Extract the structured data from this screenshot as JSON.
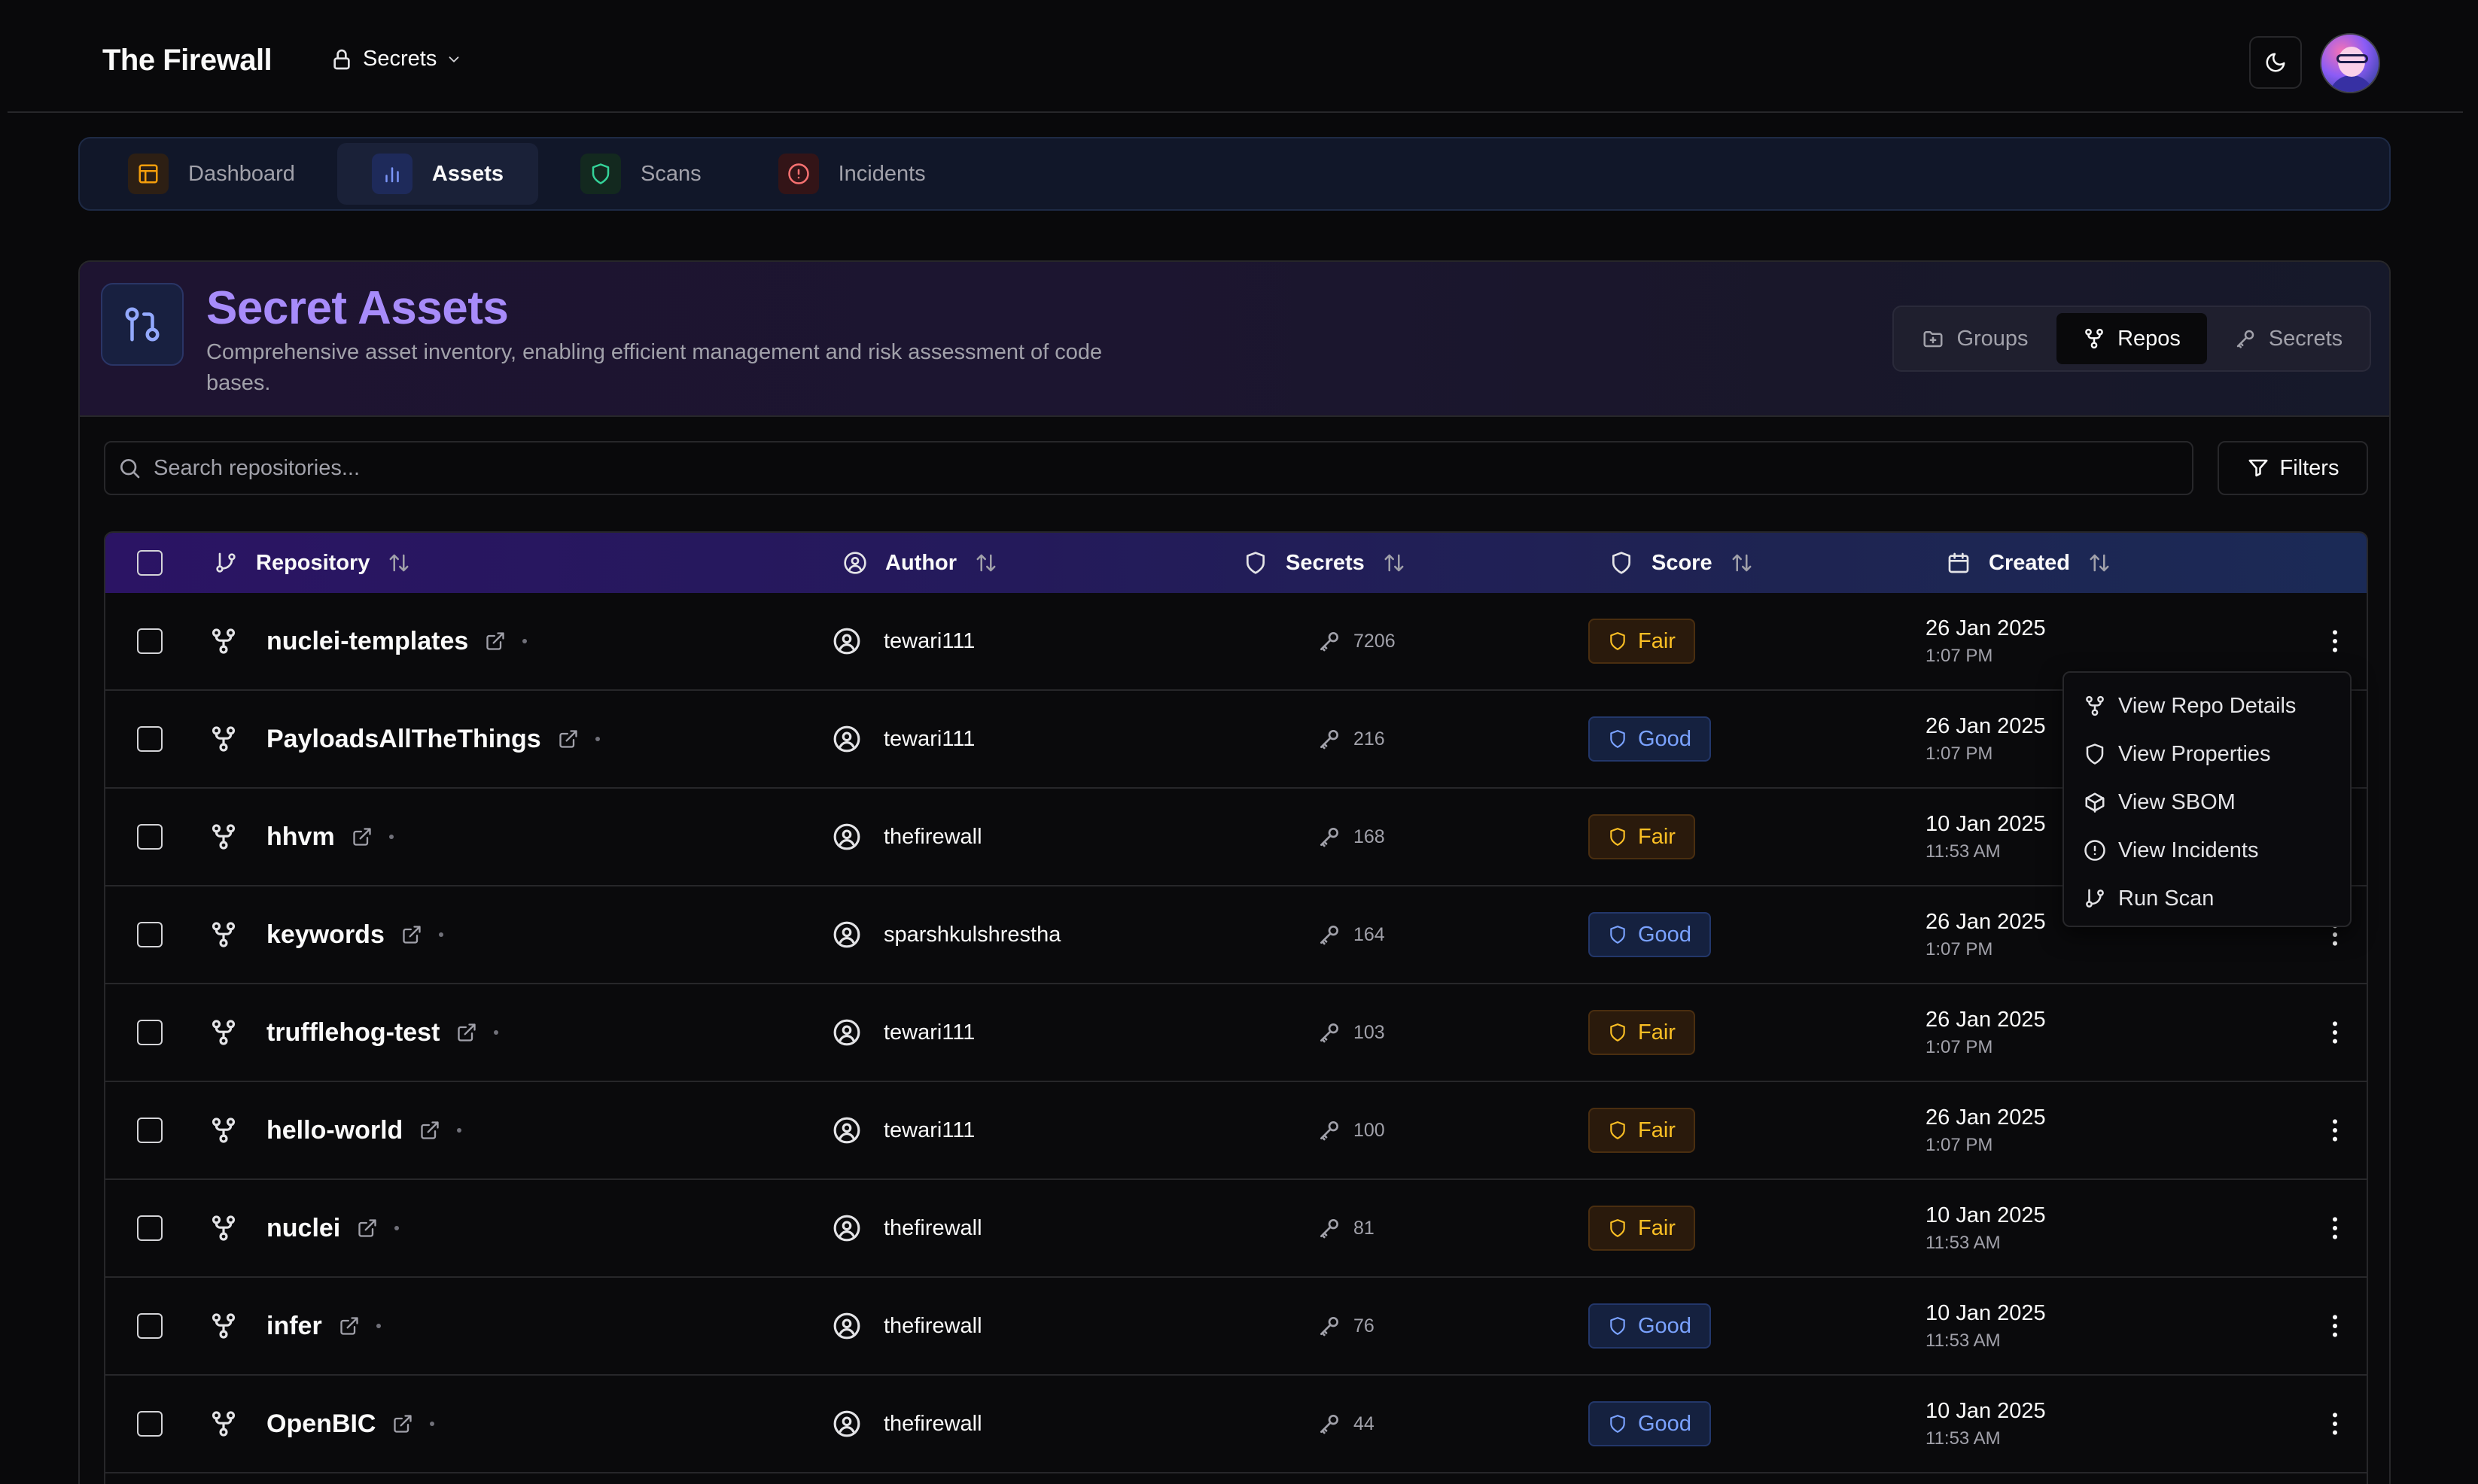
{
  "header": {
    "brand": "The Firewall",
    "context_label": "Secrets"
  },
  "nav": {
    "tabs": [
      {
        "label": "Dashboard",
        "icon": "layout-icon",
        "active": false
      },
      {
        "label": "Assets",
        "icon": "bar-chart-icon",
        "active": true
      },
      {
        "label": "Scans",
        "icon": "shield-icon",
        "active": false
      },
      {
        "label": "Incidents",
        "icon": "alert-circle-icon",
        "active": false
      }
    ]
  },
  "hero": {
    "title": "Secret Assets",
    "description": "Comprehensive asset inventory, enabling efficient management and risk assessment of code bases.",
    "segments": [
      {
        "label": "Groups",
        "active": false
      },
      {
        "label": "Repos",
        "active": true
      },
      {
        "label": "Secrets",
        "active": false
      }
    ]
  },
  "search": {
    "placeholder": "Search repositories..."
  },
  "filters_label": "Filters",
  "table": {
    "columns": [
      "Repository",
      "Author",
      "Secrets",
      "Score",
      "Created"
    ],
    "rows": [
      {
        "repo": "nuclei-templates",
        "author": "tewari111",
        "secrets": "7206",
        "score": "Fair",
        "date": "26 Jan 2025",
        "time": "1:07 PM"
      },
      {
        "repo": "PayloadsAllTheThings",
        "author": "tewari111",
        "secrets": "216",
        "score": "Good",
        "date": "26 Jan 2025",
        "time": "1:07 PM"
      },
      {
        "repo": "hhvm",
        "author": "thefirewall",
        "secrets": "168",
        "score": "Fair",
        "date": "10 Jan 2025",
        "time": "11:53 AM"
      },
      {
        "repo": "keywords",
        "author": "sparshkulshrestha",
        "secrets": "164",
        "score": "Good",
        "date": "26 Jan 2025",
        "time": "1:07 PM"
      },
      {
        "repo": "trufflehog-test",
        "author": "tewari111",
        "secrets": "103",
        "score": "Fair",
        "date": "26 Jan 2025",
        "time": "1:07 PM"
      },
      {
        "repo": "hello-world",
        "author": "tewari111",
        "secrets": "100",
        "score": "Fair",
        "date": "26 Jan 2025",
        "time": "1:07 PM"
      },
      {
        "repo": "nuclei",
        "author": "thefirewall",
        "secrets": "81",
        "score": "Fair",
        "date": "10 Jan 2025",
        "time": "11:53 AM"
      },
      {
        "repo": "infer",
        "author": "thefirewall",
        "secrets": "76",
        "score": "Good",
        "date": "10 Jan 2025",
        "time": "11:53 AM"
      },
      {
        "repo": "OpenBIC",
        "author": "thefirewall",
        "secrets": "44",
        "score": "Good",
        "date": "10 Jan 2025",
        "time": "11:53 AM"
      }
    ]
  },
  "row_menu": {
    "items": [
      {
        "label": "View Repo Details",
        "icon": "git-fork-icon"
      },
      {
        "label": "View Properties",
        "icon": "shield-icon"
      },
      {
        "label": "View SBOM",
        "icon": "package-icon"
      },
      {
        "label": "View Incidents",
        "icon": "alert-circle-icon"
      },
      {
        "label": "Run Scan",
        "icon": "git-branch-icon"
      }
    ]
  },
  "colors": {
    "accent_title": "#a78bfa",
    "fair": "#fbbf24",
    "good": "#7aa2ff",
    "background": "#09090b"
  }
}
